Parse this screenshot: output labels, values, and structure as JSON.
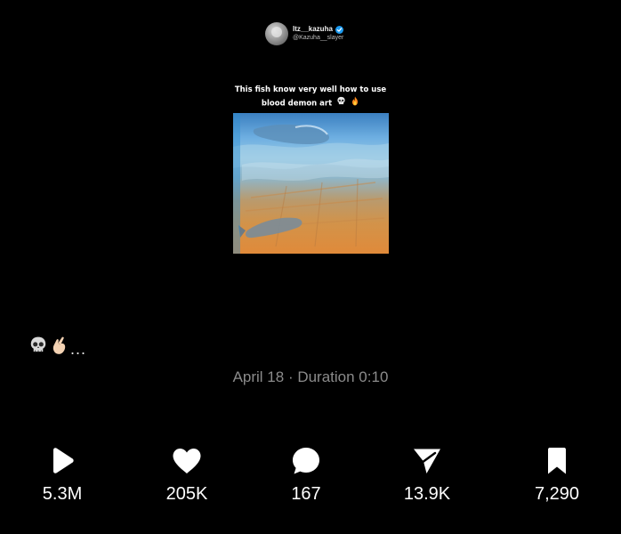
{
  "embedded_tweet": {
    "display_name": "Itz__kazuha",
    "handle": "@Kazuha__slayer",
    "caption_line1": "This fish know very well how to use",
    "caption_line2": "blood demon art",
    "caption_emojis": [
      "skull-emoji",
      "fire-emoji"
    ],
    "verified_color": "#1d9bf0"
  },
  "post": {
    "text_emojis": [
      "skull-emoji",
      "pinching-hand-emoji"
    ],
    "text_suffix": "...",
    "meta": "April 18 · Duration 0:10"
  },
  "actions": [
    {
      "icon": "play-icon",
      "count": "5.3M"
    },
    {
      "icon": "heart-icon",
      "count": "205K"
    },
    {
      "icon": "comment-icon",
      "count": "167"
    },
    {
      "icon": "share-icon",
      "count": "13.9K"
    },
    {
      "icon": "bookmark-icon",
      "count": "7,290"
    }
  ],
  "colors": {
    "background": "#000000",
    "text": "#ffffff",
    "meta_text": "#8b8b8b"
  }
}
